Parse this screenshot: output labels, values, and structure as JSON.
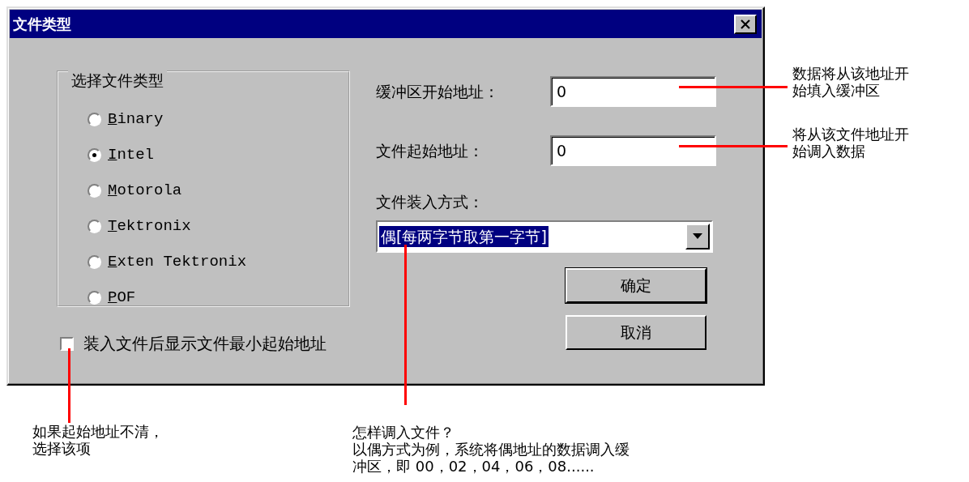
{
  "window": {
    "title": "文件类型"
  },
  "file_type_group": {
    "title": "选择文件类型",
    "options": [
      {
        "label": "Binary",
        "selected": false
      },
      {
        "label": "Intel",
        "selected": true
      },
      {
        "label": "Motorola",
        "selected": false
      },
      {
        "label": "Tektronix",
        "selected": false
      },
      {
        "label": "Exten Tektronix",
        "selected": false
      },
      {
        "label": "POF",
        "selected": false
      }
    ]
  },
  "show_min_address": {
    "label": "装入文件后显示文件最小起始地址",
    "checked": false
  },
  "fields": [
    {
      "label": "缓冲区开始地址：",
      "value": "0"
    },
    {
      "label": "文件起始地址：",
      "value": "0"
    }
  ],
  "load_mode": {
    "label": "文件装入方式：",
    "value": "偶[每两字节取第一字节]"
  },
  "buttons": [
    {
      "label": "确定",
      "default": true
    },
    {
      "label": "取消",
      "default": false
    }
  ],
  "annotations": [
    {
      "lines": [
        "数据将从该地址开",
        "始填入缓冲区"
      ]
    },
    {
      "lines": [
        "将从该文件地址开",
        "始调入数据"
      ]
    },
    {
      "lines": [
        "如果起始地址不清，",
        "选择该项"
      ]
    },
    {
      "lines": [
        "怎样调入文件？",
        "以偶方式为例，系统将偶地址的数据调入缓",
        "冲区，即 00，02，04，06，08......"
      ]
    }
  ]
}
